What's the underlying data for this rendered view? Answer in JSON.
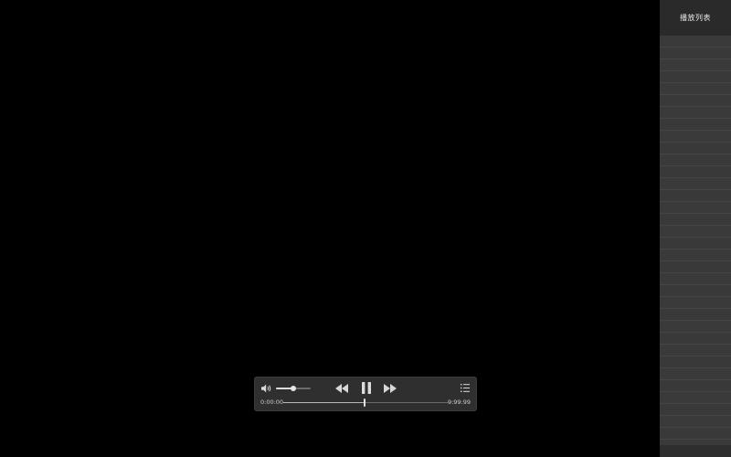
{
  "playlist": {
    "title": "播放列表",
    "row_count": 34
  },
  "controls": {
    "volume_level": 0.5,
    "progress_level": 0.49,
    "time_current": "0:00:00",
    "time_total": "9:99:99",
    "icons": {
      "volume": "speaker-icon",
      "rewind": "rewind-icon",
      "pause": "pause-icon",
      "forward": "fast-forward-icon",
      "playlist": "list-icon"
    }
  },
  "colors": {
    "video_background": "#000000",
    "control_bar": "#2f2f2f",
    "playlist_background": "#3a3a3a",
    "playlist_header": "#2a2a2a"
  }
}
